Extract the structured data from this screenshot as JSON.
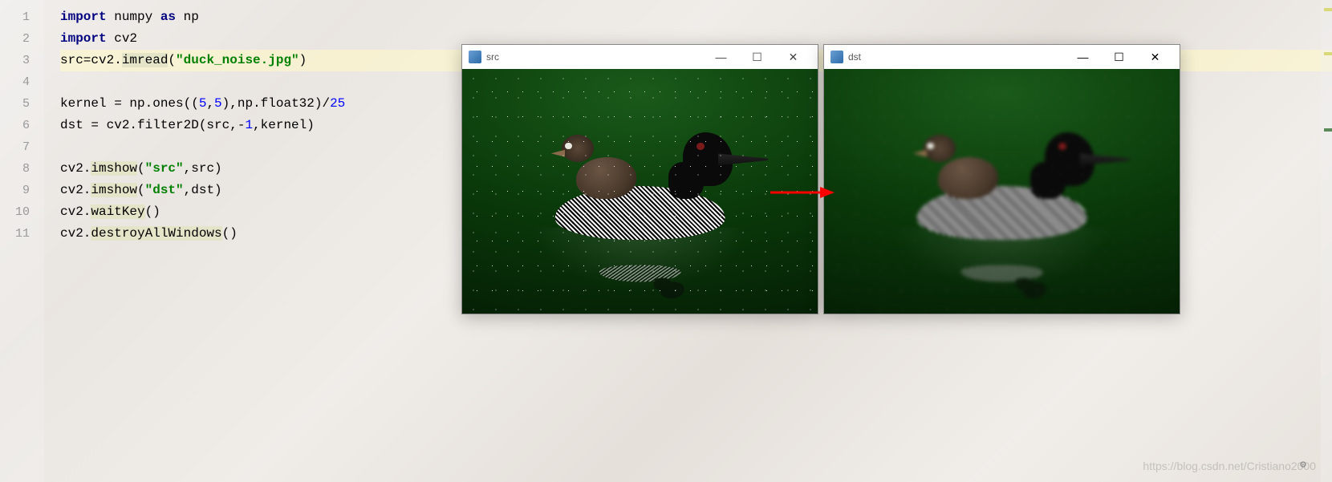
{
  "code": {
    "lines": [
      {
        "n": 1,
        "segments": [
          {
            "t": "import",
            "c": "kw"
          },
          {
            "t": " numpy "
          },
          {
            "t": "as",
            "c": "kw"
          },
          {
            "t": " np"
          }
        ]
      },
      {
        "n": 2,
        "segments": [
          {
            "t": "import",
            "c": "kw"
          },
          {
            "t": " cv2"
          }
        ]
      },
      {
        "n": 3,
        "hl": true,
        "segments": [
          {
            "t": "src=cv2."
          },
          {
            "t": "imread",
            "c": "hl-fn"
          },
          {
            "t": "("
          },
          {
            "t": "\"duck_noise.jpg\"",
            "c": "str"
          },
          {
            "t": ")"
          }
        ]
      },
      {
        "n": 4,
        "segments": []
      },
      {
        "n": 5,
        "segments": [
          {
            "t": "kernel = np."
          },
          {
            "t": "ones",
            "c": "fn"
          },
          {
            "t": "(("
          },
          {
            "t": "5",
            "c": "num"
          },
          {
            "t": ","
          },
          {
            "t": "5",
            "c": "num"
          },
          {
            "t": "),np.float32)/"
          },
          {
            "t": "25",
            "c": "num"
          }
        ]
      },
      {
        "n": 6,
        "segments": [
          {
            "t": "dst = cv2."
          },
          {
            "t": "filter2D",
            "c": "fn"
          },
          {
            "t": "(src,-"
          },
          {
            "t": "1",
            "c": "num"
          },
          {
            "t": ",kernel)"
          }
        ]
      },
      {
        "n": 7,
        "segments": []
      },
      {
        "n": 8,
        "segments": [
          {
            "t": "cv2."
          },
          {
            "t": "imshow",
            "c": "hl-fn"
          },
          {
            "t": "("
          },
          {
            "t": "\"src\"",
            "c": "str"
          },
          {
            "t": ",src)"
          }
        ]
      },
      {
        "n": 9,
        "segments": [
          {
            "t": "cv2."
          },
          {
            "t": "imshow",
            "c": "hl-fn"
          },
          {
            "t": "("
          },
          {
            "t": "\"dst\"",
            "c": "str"
          },
          {
            "t": ",dst)"
          }
        ]
      },
      {
        "n": 10,
        "segments": [
          {
            "t": "cv2."
          },
          {
            "t": "waitKey",
            "c": "hl-fn"
          },
          {
            "t": "()"
          }
        ]
      },
      {
        "n": 11,
        "segments": [
          {
            "t": "cv2."
          },
          {
            "t": "destroyAllWindows",
            "c": "hl-fn"
          },
          {
            "t": "()"
          }
        ]
      }
    ]
  },
  "windows": {
    "src": {
      "title": "src",
      "min": "—",
      "max": "☐",
      "close": "✕"
    },
    "dst": {
      "title": "dst",
      "min": "—",
      "max": "☐",
      "close": "✕"
    }
  },
  "watermark": "https://blog.csdn.net/Cristiano2000",
  "icons": {
    "gear": "⚙"
  }
}
